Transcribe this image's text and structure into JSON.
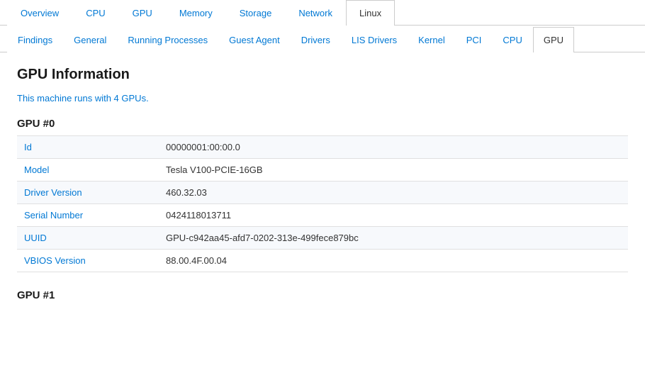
{
  "topNav": {
    "tabs": [
      {
        "label": "Overview",
        "active": false
      },
      {
        "label": "CPU",
        "active": false
      },
      {
        "label": "GPU",
        "active": false
      },
      {
        "label": "Memory",
        "active": false
      },
      {
        "label": "Storage",
        "active": false
      },
      {
        "label": "Network",
        "active": false
      },
      {
        "label": "Linux",
        "active": true
      }
    ]
  },
  "subNav": {
    "tabs": [
      {
        "label": "Findings",
        "active": false
      },
      {
        "label": "General",
        "active": false
      },
      {
        "label": "Running Processes",
        "active": false
      },
      {
        "label": "Guest Agent",
        "active": false
      },
      {
        "label": "Drivers",
        "active": false
      },
      {
        "label": "LIS Drivers",
        "active": false
      },
      {
        "label": "Kernel",
        "active": false
      },
      {
        "label": "PCI",
        "active": false
      },
      {
        "label": "CPU",
        "active": false
      },
      {
        "label": "GPU",
        "active": true
      }
    ]
  },
  "pageTitle": "GPU Information",
  "gpuCountText": "This machine runs with 4 GPUs.",
  "gpuSections": [
    {
      "title": "GPU #0",
      "rows": [
        {
          "label": "Id",
          "value": "00000001:00:00.0"
        },
        {
          "label": "Model",
          "value": "Tesla V100-PCIE-16GB"
        },
        {
          "label": "Driver Version",
          "value": "460.32.03"
        },
        {
          "label": "Serial Number",
          "value": "0424118013711"
        },
        {
          "label": "UUID",
          "value": "GPU-c942aa45-afd7-0202-313e-499fece879bc"
        },
        {
          "label": "VBIOS Version",
          "value": "88.00.4F.00.04"
        }
      ]
    },
    {
      "title": "GPU #1",
      "rows": []
    }
  ]
}
